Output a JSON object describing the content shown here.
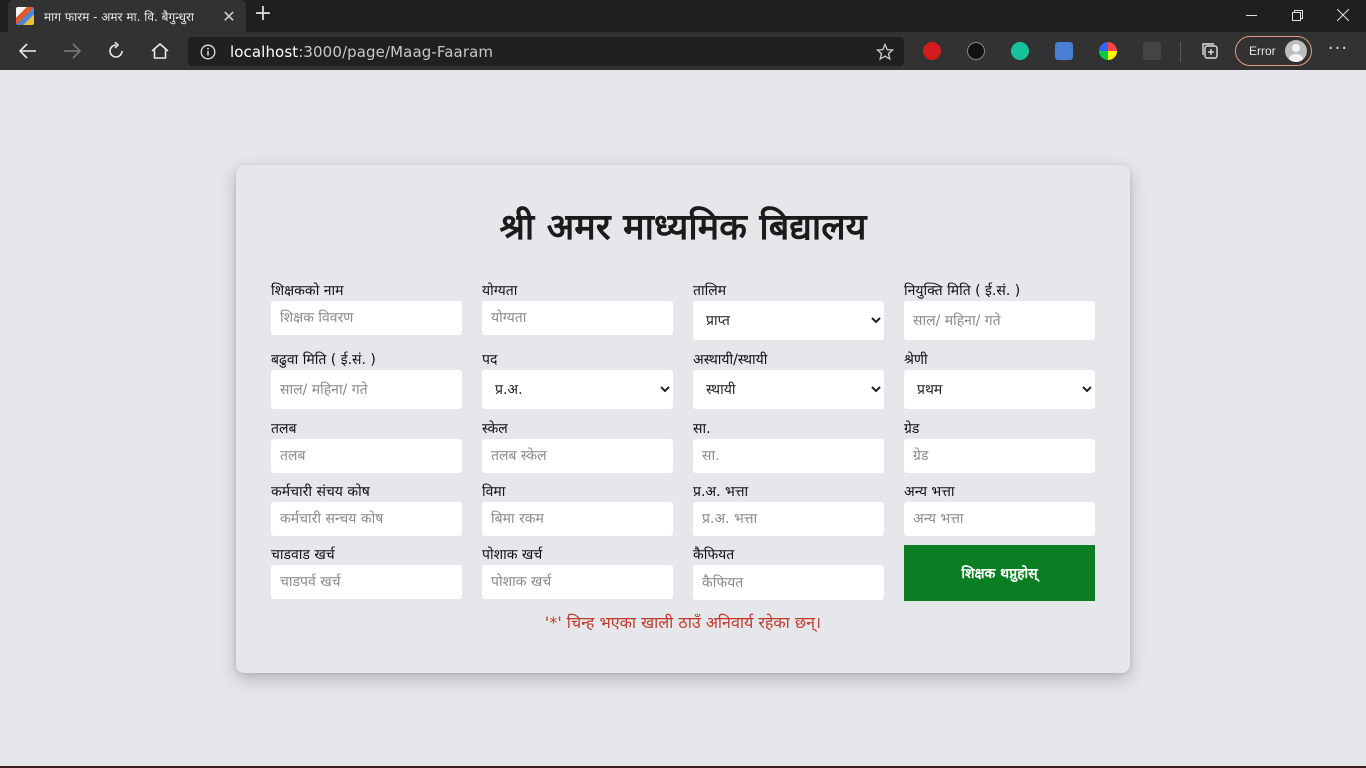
{
  "browser": {
    "tab_title": "माग फारम - अमर मा. वि. बैगुन्धुरा",
    "new_tab_label": "+",
    "url_host": "localhost",
    "url_path": ":3000/page/Maag-Faaram",
    "profile_label": "Error",
    "more_label": "···",
    "extensions": [
      "adblock-icon",
      "mendeley-icon",
      "grammarly-icon",
      "google-translate-icon",
      "color-picker-icon",
      "sheets-icon"
    ]
  },
  "page": {
    "title": "श्री अमर माध्यमिक बिद्यालय",
    "note": "'*' चिन्ह भएका खाली ठाउँ अनिवार्य रहेका छन्।",
    "submit_label": "शिक्षक थप्नुहोस्",
    "accent_color": "#0b7d23",
    "note_color": "#c0392b"
  },
  "fields": {
    "name": {
      "label": "शिक्षकको नाम",
      "placeholder": "शिक्षक विवरण"
    },
    "qualification": {
      "label": "योग्यता",
      "placeholder": "योग्यता"
    },
    "training": {
      "label": "तालिम",
      "value": "प्राप्त"
    },
    "appointment_date": {
      "label": "नियुक्ति मिति ( ई.सं. )",
      "placeholder": "साल/ महिना/ गते"
    },
    "promotion_date": {
      "label": "बढुवा मिति ( ई.सं. )",
      "placeholder": "साल/ महिना/ गते"
    },
    "post": {
      "label": "पद",
      "value": "प्र.अ."
    },
    "status": {
      "label": "अस्थायी/स्थायी",
      "value": "स्थायी"
    },
    "category": {
      "label": "श्रेणी",
      "value": "प्रथम"
    },
    "salary": {
      "label": "तलब",
      "placeholder": "तलब"
    },
    "scale": {
      "label": "स्केल",
      "placeholder": "तलब स्केल"
    },
    "sa": {
      "label": "सा.",
      "placeholder": "सा."
    },
    "grade": {
      "label": "ग्रेड",
      "placeholder": "ग्रेड"
    },
    "provident_fund": {
      "label": "कर्मचारी संचय कोष",
      "placeholder": "कर्मचारी सन्चय कोष"
    },
    "insurance": {
      "label": "विमा",
      "placeholder": "बिमा रकम"
    },
    "head_allowance": {
      "label": "प्र.अ. भत्ता",
      "placeholder": "प्र.अ. भत्ता"
    },
    "other_allowance": {
      "label": "अन्य भत्ता",
      "placeholder": "अन्य भत्ता"
    },
    "festival_expense": {
      "label": "चाडवाड खर्च",
      "placeholder": "चाडपर्व खर्च"
    },
    "uniform_expense": {
      "label": "पोशाक खर्च",
      "placeholder": "पोशाक खर्च"
    },
    "remarks": {
      "label": "कैफियत",
      "placeholder": "कैफियत"
    }
  }
}
